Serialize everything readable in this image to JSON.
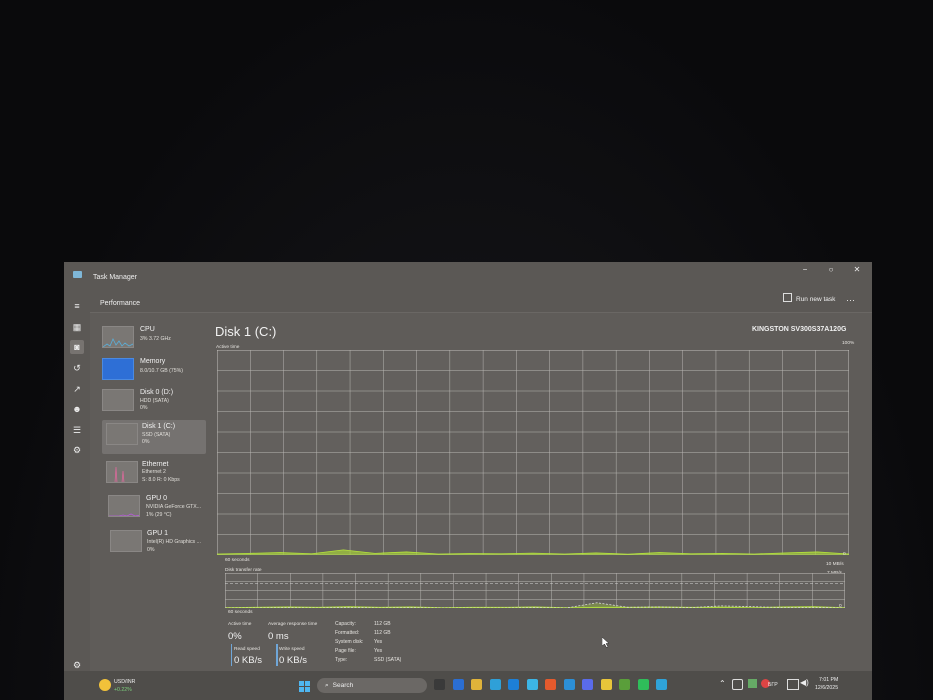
{
  "app": {
    "title": "Task Manager"
  },
  "window_controls": {
    "minimize": "−",
    "maximize": "○",
    "close": "✕"
  },
  "header": {
    "title": "Performance",
    "run_new_task": "Run new task",
    "more": "···"
  },
  "nav_icons": [
    "hamburger-icon",
    "processes-icon",
    "performance-icon",
    "app-history-icon",
    "startup-apps-icon",
    "users-icon",
    "details-icon",
    "services-icon",
    "settings-icon"
  ],
  "sidebar": {
    "items": [
      {
        "title": "CPU",
        "line1": "3% 3.72 GHz",
        "line2": ""
      },
      {
        "title": "Memory",
        "line1": "8.0/10.7 GB (75%)",
        "line2": ""
      },
      {
        "title": "Disk 0 (D:)",
        "line1": "HDD (SATA)",
        "line2": "0%"
      },
      {
        "title": "Disk 1 (C:)",
        "line1": "SSD (SATA)",
        "line2": "0%"
      },
      {
        "title": "Ethernet",
        "line1": "Ethernet 2",
        "line2": "S: 8.0 R: 0 Kbps"
      },
      {
        "title": "GPU 0",
        "line1": "NVIDIA GeForce GTX...",
        "line2": "1% (29 °C)"
      },
      {
        "title": "GPU 1",
        "line1": "Intel(R) HD Graphics ...",
        "line2": "0%"
      }
    ]
  },
  "main": {
    "title": "Disk 1 (C:)",
    "model": "KINGSTON SV300S37A120G",
    "active_time_label": "Active time",
    "active_time_max": "100%",
    "active_time_min": "0",
    "active_time_span": "60 seconds",
    "transfer_label": "Disk transfer rate",
    "transfer_max": "10 MB/s",
    "transfer_ref": "7 MB/s",
    "transfer_min": "0",
    "transfer_span": "60 seconds"
  },
  "stats": {
    "active_time_label": "Active time",
    "active_time_value": "0%",
    "avg_response_label": "Average response time",
    "avg_response_value": "0 ms",
    "read_speed_label": "Read speed",
    "read_speed_value": "0 KB/s",
    "write_speed_label": "Write speed",
    "write_speed_value": "0 KB/s"
  },
  "properties": [
    {
      "label": "Capacity:",
      "value": "112 GB"
    },
    {
      "label": "Formatted:",
      "value": "112 GB"
    },
    {
      "label": "System disk:",
      "value": "Yes"
    },
    {
      "label": "Page file:",
      "value": "Yes"
    },
    {
      "label": "Type:",
      "value": "SSD (SATA)"
    }
  ],
  "chart_data": [
    {
      "type": "area",
      "title": "Active time",
      "x": [
        0,
        3,
        6,
        9,
        12,
        15,
        18,
        21,
        24,
        27,
        30,
        33,
        36,
        39,
        42,
        45,
        48,
        51,
        54,
        57,
        60
      ],
      "series": [
        {
          "values": [
            0.5,
            0.8,
            1.2,
            0.6,
            2.5,
            0.8,
            1.5,
            0.5,
            0.7,
            0.6,
            0.9,
            0.5,
            1.0,
            0.4,
            1.2,
            0.6,
            0.8,
            0.5,
            1.0,
            1.5,
            0.5
          ]
        }
      ],
      "ylim": [
        0,
        100
      ],
      "colors": {
        "line": "#b4e23c",
        "fill": "#a6d23a"
      }
    },
    {
      "type": "area",
      "title": "Disk transfer rate",
      "x": [
        0,
        3,
        6,
        9,
        12,
        15,
        18,
        21,
        24,
        27,
        30,
        33,
        36,
        39,
        42,
        45,
        48,
        51,
        54,
        57,
        60
      ],
      "series": [
        {
          "values": [
            0.1,
            0.2,
            0.3,
            0.2,
            0.4,
            0.2,
            0.3,
            0.1,
            0.2,
            0.2,
            0.3,
            0.1,
            0.2,
            0.2,
            0.3,
            0.2,
            0.2,
            0.1,
            0.3,
            0.4,
            0.1
          ]
        },
        {
          "values": [
            0,
            0,
            0.1,
            0,
            0.2,
            0,
            0.1,
            0,
            0,
            0,
            0.1,
            0,
            1.5,
            0.2,
            0.3,
            0.1,
            0.6,
            0.4,
            0.1,
            0.2,
            0
          ]
        }
      ],
      "ylim": [
        0,
        10
      ],
      "reference": 7,
      "colors": {
        "line": "#b4e23c",
        "fill": "#a6d23a",
        "dashed": "#d8d8d8"
      }
    }
  ],
  "taskbar": {
    "ticker_symbol": "USD/INR",
    "ticker_change": "+0.22%",
    "search_placeholder": "Search",
    "language": "БГР",
    "time": "7:01 PM",
    "date": "12/6/2025",
    "app_icons": [
      "task-view-icon",
      "widgets-icon",
      "file-explorer-icon",
      "edge-icon",
      "store-icon",
      "photos-icon",
      "brave-icon",
      "vscode-icon",
      "discord-icon",
      "chrome-icon",
      "minecraft-icon",
      "spotify-icon",
      "task-manager-icon"
    ],
    "app_colors": [
      "#3a3a3a",
      "#2b6ed3",
      "#e0b33a",
      "#2fa0d8",
      "#1d7fd6",
      "#3cb6e6",
      "#e45a2d",
      "#2c8fd6",
      "#5a6bea",
      "#e8c53a",
      "#5a9e3a",
      "#2fbd5a",
      "#2fa3d8"
    ]
  }
}
